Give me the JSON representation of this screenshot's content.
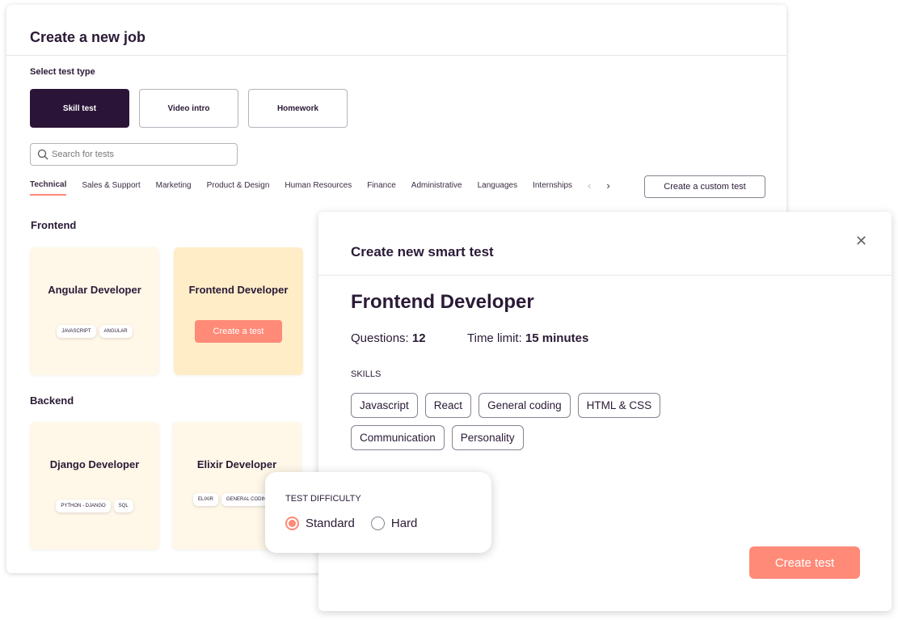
{
  "page": {
    "title": "Create a new job",
    "select_label": "Select test type",
    "types": [
      "Skill test",
      "Video intro",
      "Homework"
    ],
    "search_placeholder": "Search for tests",
    "tabs": [
      "Technical",
      "Sales & Support",
      "Marketing",
      "Product & Design",
      "Human Resources",
      "Finance",
      "Administrative",
      "Languages",
      "Internships"
    ],
    "custom_button": "Create a custom test",
    "sections": [
      {
        "name": "Frontend",
        "cards": [
          {
            "title": "Angular Developer",
            "tags": [
              "JAVASCRIPT",
              "ANGULAR"
            ]
          },
          {
            "title": "Frontend  Developer",
            "button": "Create a test"
          }
        ]
      },
      {
        "name": "Backend",
        "cards": [
          {
            "title": "Django Developer",
            "tags": [
              "PYTHON - DJANGO",
              "SQL"
            ]
          },
          {
            "title": "Elixir Developer",
            "tags": [
              "ELIXIR",
              "GENERAL CODING"
            ]
          }
        ]
      }
    ]
  },
  "modal": {
    "title": "Create new smart test",
    "job": "Frontend Developer",
    "questions_label": "Questions:",
    "questions": "12",
    "time_label": "Time limit:",
    "time": "15 minutes",
    "skills_label": "SKILLS",
    "skills": [
      "Javascript",
      "React",
      "General coding",
      "HTML & CSS",
      "Communication",
      "Personality"
    ],
    "create_button": "Create test"
  },
  "difficulty": {
    "label": "TEST DIFFICULTY",
    "options": [
      "Standard",
      "Hard"
    ],
    "selected": "Standard"
  },
  "colors": {
    "accent": "#ff8a78",
    "dark": "#2a1538",
    "card": "#fff7e8",
    "card_hover": "#ffedc8"
  }
}
